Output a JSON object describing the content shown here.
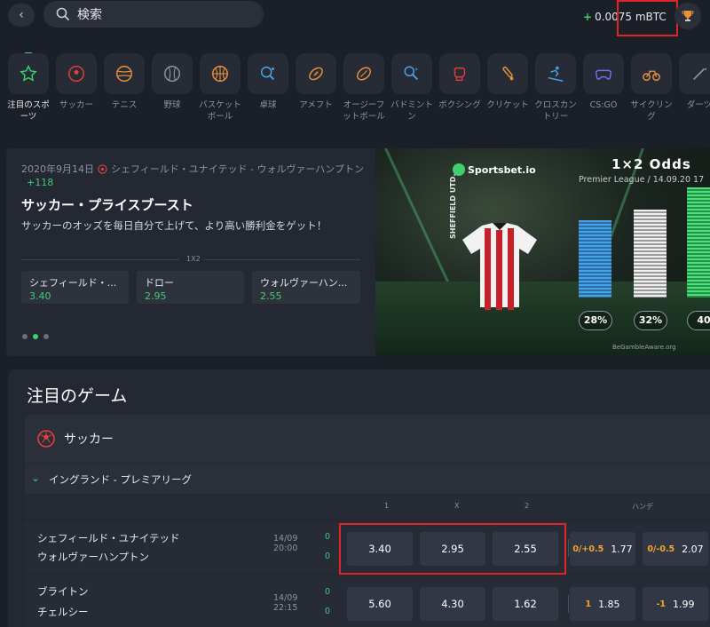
{
  "topbar": {
    "back_glyph": "‹",
    "search_placeholder": "検索",
    "balance_sign": "+",
    "balance": "0.0075 mBTC"
  },
  "sports": [
    {
      "label": "注目のスポーツ",
      "icon": "star-icon",
      "active": true
    },
    {
      "label": "サッカー",
      "icon": "soccer-icon"
    },
    {
      "label": "テニス",
      "icon": "tennis-icon"
    },
    {
      "label": "野球",
      "icon": "baseball-icon"
    },
    {
      "label": "バスケットボール",
      "icon": "basketball-icon"
    },
    {
      "label": "卓球",
      "icon": "table-tennis-icon"
    },
    {
      "label": "アメフト",
      "icon": "american-football-icon"
    },
    {
      "label": "オージーフットボール",
      "icon": "aussie-rules-icon"
    },
    {
      "label": "バドミントン",
      "icon": "badminton-icon"
    },
    {
      "label": "ボクシング",
      "icon": "boxing-icon"
    },
    {
      "label": "クリケット",
      "icon": "cricket-icon"
    },
    {
      "label": "クロスカントリー",
      "icon": "skiing-icon"
    },
    {
      "label": "CS:GO",
      "icon": "gamepad-icon"
    },
    {
      "label": "サイクリング",
      "icon": "cycling-icon"
    },
    {
      "label": "ダーツ",
      "icon": "darts-icon"
    }
  ],
  "promo": {
    "date": "2020年9月14日",
    "match": "シェフィールド・ユナイテッド - ウォルヴァーハンプトン",
    "market_count": "+118",
    "title": "サッカー・プライスブースト",
    "description": "サッカーのオッズを毎日自分で上げて、より高い勝利金をゲット！",
    "market_label": "1X2",
    "odds": [
      {
        "name": "シェフィールド・...",
        "value": "3.40"
      },
      {
        "name": "ドロー",
        "value": "2.95"
      },
      {
        "name": "ウォルヴァーハン...",
        "value": "2.55"
      }
    ]
  },
  "banner": {
    "brand": "Sportsbet.io",
    "title": "1×2 Odds",
    "subtitle": "Premier League / 14.09.20 17",
    "team": "SHEFFIELD UTD.",
    "percents": [
      {
        "value": 28,
        "label": "28%"
      },
      {
        "value": 32,
        "label": "32%"
      },
      {
        "value": 40,
        "label": "40"
      }
    ],
    "gamble_aware": "BeGambleAware.org",
    "bar_colors": [
      "#4aa3e8",
      "#f0f0f0",
      "#4ce07a"
    ]
  },
  "featured": {
    "title": "注目のゲーム",
    "sport": "サッカー",
    "league": "イングランド - プレミアリーグ",
    "col_headers": [
      "1",
      "X",
      "2",
      "ハンデ"
    ],
    "matches": [
      {
        "home": "シェフィールド・ユナイテッド",
        "away": "ウォルヴァーハンプトン",
        "date": "14/09",
        "time": "20:00",
        "score_home": "0",
        "score_away": "0",
        "odds": [
          "3.40",
          "2.95",
          "2.55"
        ],
        "handicaps": [
          {
            "h": "0/+0.5",
            "v": "1.77"
          },
          {
            "h": "0/-0.5",
            "v": "2.07"
          }
        ]
      },
      {
        "home": "ブライトン",
        "away": "チェルシー",
        "date": "14/09",
        "time": "22:15",
        "score_home": "0",
        "score_away": "0",
        "odds": [
          "5.60",
          "4.30",
          "1.62"
        ],
        "handicaps": [
          {
            "h": "1",
            "v": "1.85"
          },
          {
            "h": "-1",
            "v": "1.99"
          }
        ]
      }
    ]
  },
  "colors": {
    "accent": "#3fcf6f",
    "highlight": "#e0252a",
    "handicap": "#f3a62a"
  }
}
